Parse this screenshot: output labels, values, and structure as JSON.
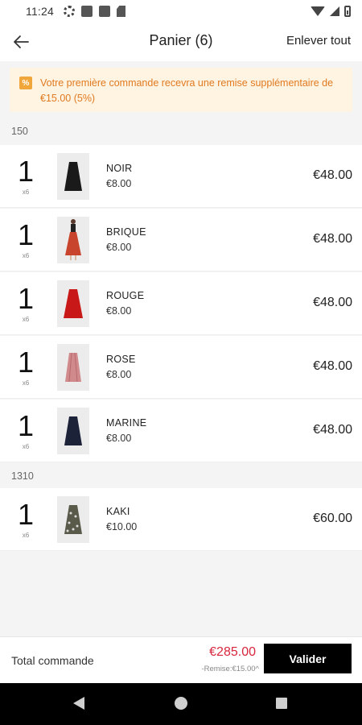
{
  "status_bar": {
    "time": "11:24",
    "icons": [
      "gear-icon",
      "notification-square-icon",
      "notification-square-icon",
      "sd-card-icon",
      "wifi-icon",
      "signal-icon",
      "battery-icon"
    ]
  },
  "header": {
    "back_icon": "arrow-left-icon",
    "title": "Panier (6)",
    "remove_all_label": "Enlever tout"
  },
  "promo_banner": {
    "icon": "percent-icon",
    "text": "Votre première commande recevra une remise supplémentaire de €15.00 (5%)",
    "color": "#e07a20",
    "background": "#fff3e1"
  },
  "groups": [
    {
      "label": "150",
      "items": [
        {
          "qty": "1",
          "qty_sub": "x6",
          "name": "NOIR",
          "unit_price": "€8.00",
          "total": "€48.00",
          "skirt_color": "#1a1a1a"
        },
        {
          "qty": "1",
          "qty_sub": "x6",
          "name": "BRIQUE",
          "unit_price": "€8.00",
          "total": "€48.00",
          "skirt_color": "#c9442d"
        },
        {
          "qty": "1",
          "qty_sub": "x6",
          "name": "ROUGE",
          "unit_price": "€8.00",
          "total": "€48.00",
          "skirt_color": "#c81818"
        },
        {
          "qty": "1",
          "qty_sub": "x6",
          "name": "ROSE",
          "unit_price": "€8.00",
          "total": "€48.00",
          "skirt_color": "#d08a8c"
        },
        {
          "qty": "1",
          "qty_sub": "x6",
          "name": "MARINE",
          "unit_price": "€8.00",
          "total": "€48.00",
          "skirt_color": "#1c2238"
        }
      ]
    },
    {
      "label": "1310",
      "items": [
        {
          "qty": "1",
          "qty_sub": "x6",
          "name": "KAKI",
          "unit_price": "€10.00",
          "total": "€60.00",
          "skirt_color": "#5a5a4a"
        }
      ]
    }
  ],
  "footer": {
    "total_label": "Total commande",
    "total_price": "€285.00",
    "discount_note": "-Remise:€15.00",
    "validate_label": "Valider",
    "price_color": "#d7263d"
  },
  "nav_bar": {
    "icons": [
      "back-triangle-icon",
      "home-circle-icon",
      "recent-apps-square-icon"
    ]
  }
}
